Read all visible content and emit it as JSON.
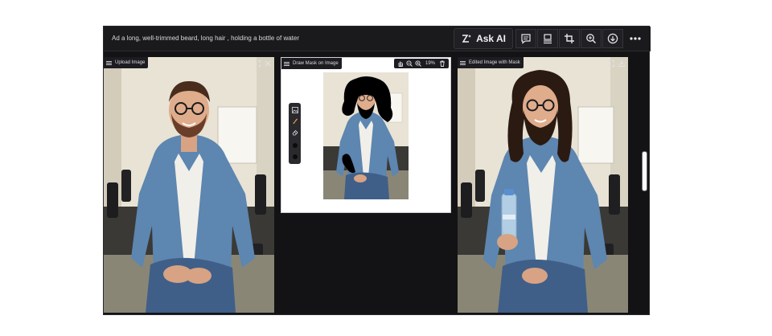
{
  "prompt": "Ad a long, well-trimmed beard, long hair , holding a bottle of water",
  "toolbar": {
    "ask_ai_label": "Ask AI",
    "icons": [
      "sparkle-ai-icon",
      "chat-icon",
      "layout-icon",
      "crop-icon",
      "zoom-in-icon",
      "download-icon",
      "more-icon"
    ]
  },
  "panels": {
    "upload": {
      "title": "Upload Image"
    },
    "mask": {
      "title": "Draw Mask on Image",
      "zoom": "19%"
    },
    "edited": {
      "title": "Edited Image with Mask"
    }
  },
  "colors": {
    "app_bg": "#131316",
    "panel_bg": "#0e0e10",
    "shirt": "#5d86b0",
    "wall": "#e7e2d4"
  }
}
